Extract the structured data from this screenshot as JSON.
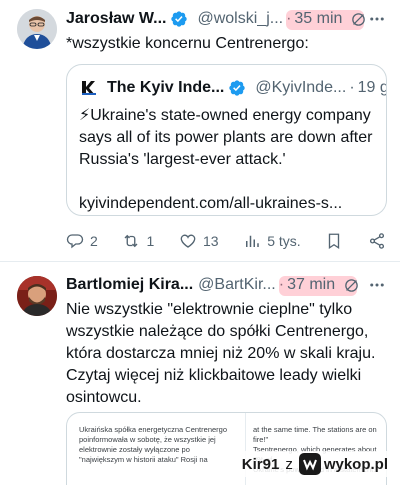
{
  "tweets": [
    {
      "author_name": "Jarosław W...",
      "handle": "@wolski_j...",
      "separator": "·",
      "time": "35 min",
      "text": "*wszystkie koncernu Centrenergo:",
      "quote": {
        "author_name": "The Kyiv Inde...",
        "handle": "@KyivInde...",
        "separator": "·",
        "time": "19 g.",
        "text": "⚡Ukraine's state-owned energy company says all of its power plants are down after Russia's 'largest-ever attack.'\n\nkyivindependent.com/all-ukraines-s..."
      },
      "actions": {
        "replies": "2",
        "retweets": "1",
        "likes": "13",
        "views": "5 tys."
      }
    },
    {
      "author_name": "Bartlomiej Kira...",
      "handle": "@BartKir...",
      "separator": "·",
      "time": "37 min",
      "text": "Nie wszystkie \"elektrownie cieplne\" tylko wszystkie należące do spółki Centrenergo, która dostarcza mniej niż 20% w skali kraju. Czytaj więcej niż klickbaitowe leady wielki osintowcu.",
      "preview": {
        "left_text": "Ukraińska spółka energetyczna Centrenergo\npoinformowała w sobotę, że wszystkie jej\nelektrownie zostały wyłączone po\n\"największym w historii ataku\" Rosji na",
        "right_text": "at the same time. The stations are on fire!\"\nTsentrenergo, which generates about 8% of\nUkraine's power, said in a statement.\n\n\"Our generation is now zero.\""
      }
    }
  ],
  "watermark": {
    "user": "Kir91",
    "connector": "z",
    "site": "wykop.pl"
  },
  "colors": {
    "verified": "#1d9bf0",
    "secondary_text": "#536471",
    "highlight": "#ff6e82",
    "border": "#cfd9de"
  },
  "icons": [
    "verified-badge-icon",
    "grok-icon",
    "more-icon",
    "reply-icon",
    "retweet-icon",
    "like-icon",
    "views-icon",
    "bookmark-icon",
    "share-icon",
    "kyiv-independent-logo-icon",
    "wykop-logo-icon"
  ]
}
